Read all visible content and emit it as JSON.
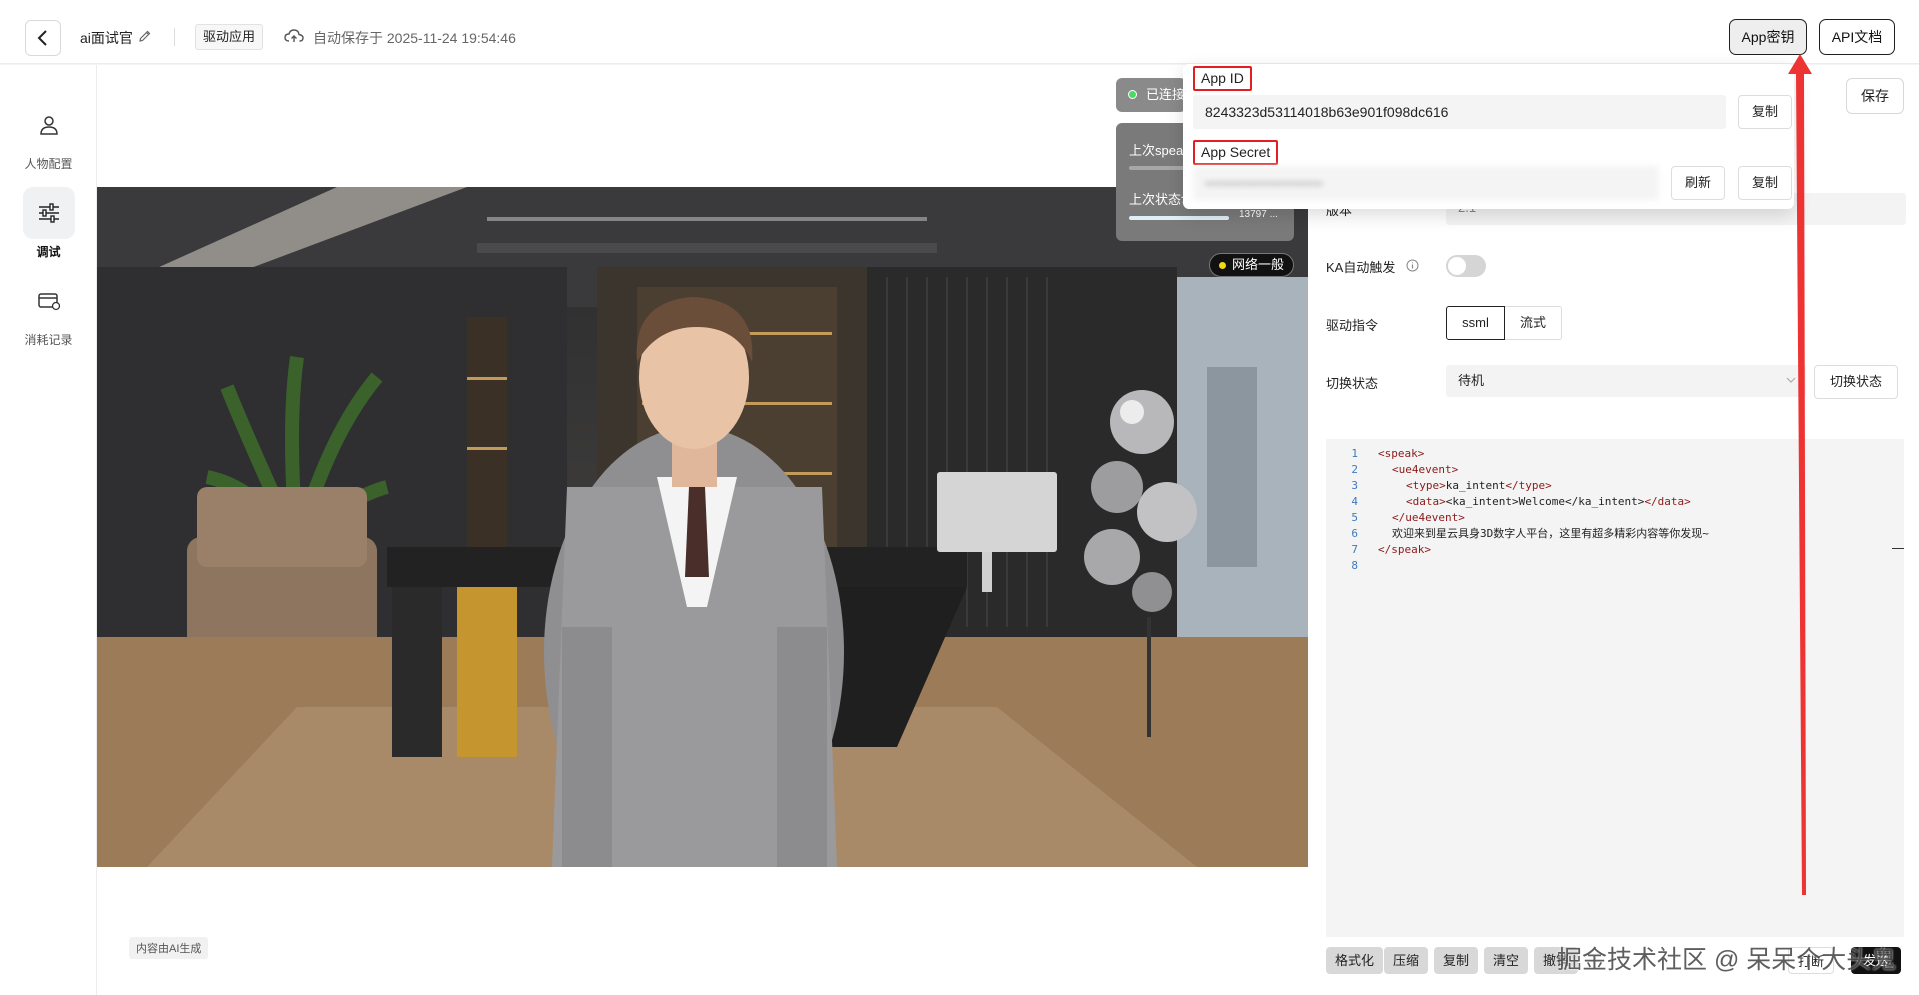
{
  "header": {
    "app_name": "ai面试官",
    "tab_label": "驱动应用",
    "autosave_text": "自动保存于 2025-11-24 19:54:46",
    "app_key_label": "App密钥",
    "api_docs_label": "API文档"
  },
  "sidebar": {
    "items": [
      {
        "label": "人物配置",
        "icon": "person-icon",
        "active": false
      },
      {
        "label": "调试",
        "icon": "sliders-icon",
        "active": true
      },
      {
        "label": "消耗记录",
        "icon": "card-icon",
        "active": false
      }
    ]
  },
  "stage": {
    "status_text": "已连接",
    "stats_line1": "上次speak耗时",
    "stats_line2": "上次状态切换耗时",
    "stats_value": "13797 ...",
    "network_badge": "网络一般",
    "ai_note": "内容由AI生成"
  },
  "popover": {
    "app_id_label": "App ID",
    "app_id_value": "8243323d53114018b63e901f098dc616",
    "app_secret_label": "App Secret",
    "app_secret_value": "••••••••••••••••••••••••",
    "copy_label": "复制",
    "refresh_label": "刷新"
  },
  "panel": {
    "save_label": "保存",
    "version_label": "版本",
    "version_value": "2.1",
    "ka_label": "KA自动触发",
    "ka_enabled": false,
    "drive_cmd_label": "驱动指令",
    "mode_ssml": "ssml",
    "mode_stream": "流式",
    "switch_state_label": "切换状态",
    "state_value": "待机",
    "switch_state_button": "切换状态",
    "code_lines": [
      {
        "n": "1",
        "tag": "<speak>",
        "text": ""
      },
      {
        "n": "2",
        "tag": "<ue4event>",
        "text": ""
      },
      {
        "n": "3",
        "tag": "<type>",
        "text": "ka_intent",
        "close": "</type>"
      },
      {
        "n": "4",
        "tag": "<data>",
        "text": "<ka_intent>Welcome</ka_intent>",
        "close": "</data>"
      },
      {
        "n": "5",
        "tag": "</ue4event>",
        "text": ""
      },
      {
        "n": "6",
        "tag": "",
        "text": "欢迎来到星云具身3D数字人平台，这里有超多精彩内容等你发现~"
      },
      {
        "n": "7",
        "tag": "</speak>",
        "text": ""
      },
      {
        "n": "8",
        "tag": "",
        "text": ""
      }
    ],
    "format_label": "格式化",
    "compress_label": "压缩",
    "copy_label": "复制",
    "clear_label": "清空",
    "undo_label": "撤销",
    "run_label": "打断",
    "send_label": "发送"
  },
  "watermark": "掘金技术社区 @ 呆呆个大头鬼"
}
